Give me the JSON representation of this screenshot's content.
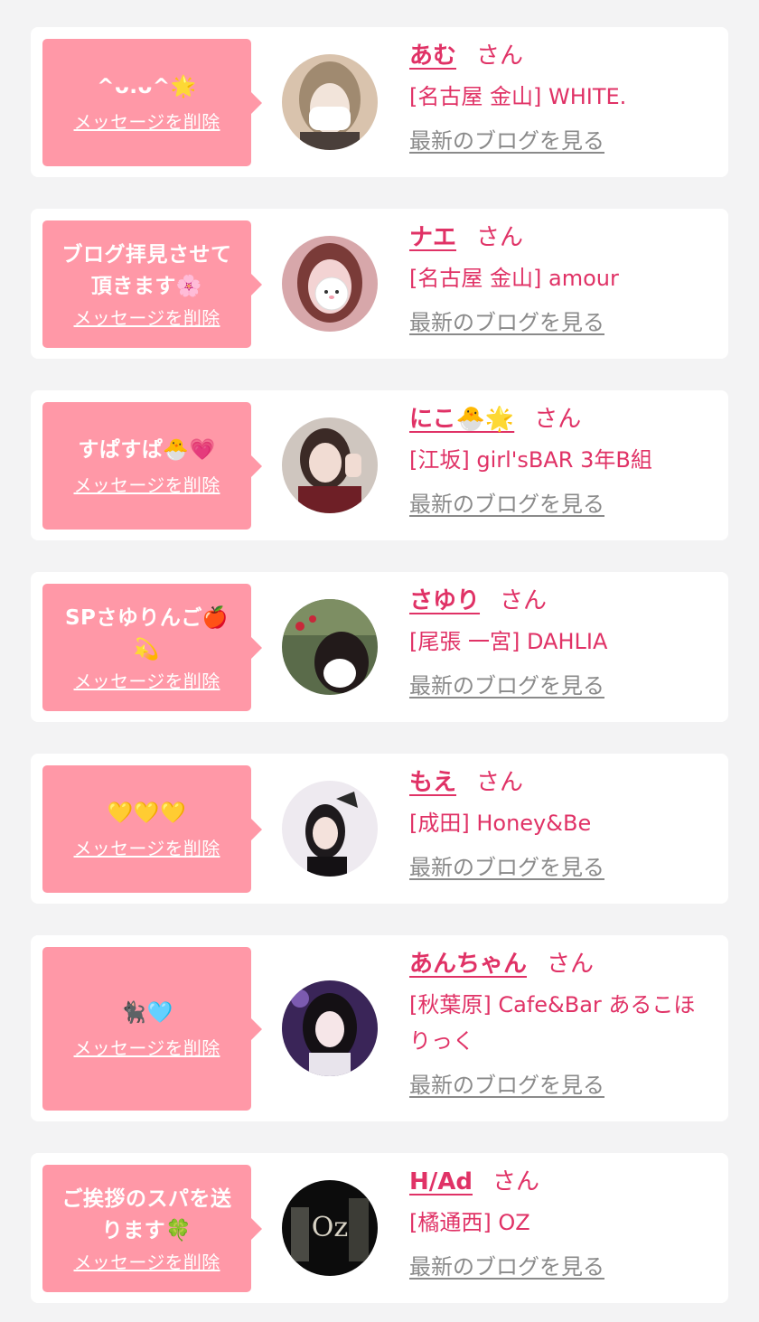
{
  "colors": {
    "background": "#f3f3f4",
    "card": "#ffffff",
    "bubble": "#ff98a7",
    "accent": "#e03266",
    "link_gray": "#8a8a8a"
  },
  "delete_label": "メッセージを削除",
  "san_label": "さん",
  "blog_label": "最新のブログを見る",
  "entries": [
    {
      "message": "^ᴗ.ᴗ^🌟",
      "name": "あむ",
      "shop": "[名古屋 金山] WHITE.",
      "avatar_icon": "avatar-photo"
    },
    {
      "message": "ブログ拝見させて頂きます🌸",
      "name": "ナエ",
      "shop": "[名古屋 金山] amour",
      "avatar_icon": "avatar-photo"
    },
    {
      "message": "すぱすぱ🐣💗",
      "name": "にこ🐣🌟",
      "shop": "[江坂] girl'sBAR 3年B組",
      "avatar_icon": "avatar-photo"
    },
    {
      "message": "SPさゆりんご🍎💫",
      "name": "さゆり",
      "shop": "[尾張 一宮] DAHLIA",
      "avatar_icon": "avatar-photo"
    },
    {
      "message": "💛💛💛",
      "name": "もえ",
      "shop": "[成田] Honey&Be",
      "avatar_icon": "avatar-photo"
    },
    {
      "message": "🐈‍⬛🩵",
      "name": "あんちゃん",
      "shop": "[秋葉原] Cafe&Bar あるこほりっく",
      "avatar_icon": "avatar-photo"
    },
    {
      "message": "ご挨拶のスパを送ります🍀",
      "name": "H/Ad",
      "shop": "[橘通西] OZ",
      "avatar_icon": "avatar-photo"
    }
  ]
}
